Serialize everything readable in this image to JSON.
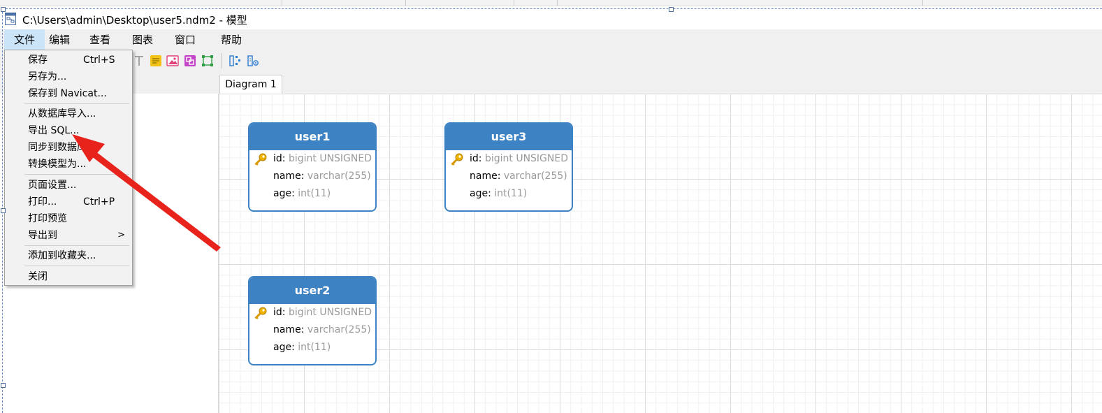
{
  "window": {
    "title": "C:\\Users\\admin\\Desktop\\user5.ndm2 - 模型"
  },
  "menubar": {
    "items": [
      {
        "label": "文件"
      },
      {
        "label": "编辑"
      },
      {
        "label": "查看"
      },
      {
        "label": "图表"
      },
      {
        "label": "窗口"
      },
      {
        "label": "帮助"
      }
    ]
  },
  "tabs": [
    {
      "label": "Diagram 1"
    }
  ],
  "file_menu": {
    "items": [
      {
        "label": "保存",
        "shortcut": "Ctrl+S"
      },
      {
        "label": "另存为..."
      },
      {
        "label": "保存到 Navicat..."
      },
      {
        "label": "从数据库导入..."
      },
      {
        "label": "导出 SQL..."
      },
      {
        "label": "同步到数据库..."
      },
      {
        "label": "转换模型为..."
      },
      {
        "label": "页面设置..."
      },
      {
        "label": "打印...",
        "shortcut": "Ctrl+P"
      },
      {
        "label": "打印预览"
      },
      {
        "label": "导出到",
        "submenu_arrow": ">"
      },
      {
        "label": "添加到收藏夹..."
      },
      {
        "label": "关闭"
      }
    ]
  },
  "entities": [
    {
      "name": "user1",
      "fields": [
        {
          "name": "id",
          "type": "bigint UNSIGNED",
          "primary_key": true
        },
        {
          "name": "name",
          "type": "varchar(255)"
        },
        {
          "name": "age",
          "type": "int(11)"
        }
      ]
    },
    {
      "name": "user3",
      "fields": [
        {
          "name": "id",
          "type": "bigint UNSIGNED",
          "primary_key": true
        },
        {
          "name": "name",
          "type": "varchar(255)"
        },
        {
          "name": "age",
          "type": "int(11)"
        }
      ]
    },
    {
      "name": "user2",
      "fields": [
        {
          "name": "id",
          "type": "bigint UNSIGNED",
          "primary_key": true
        },
        {
          "name": "name",
          "type": "varchar(255)"
        },
        {
          "name": "age",
          "type": "int(11)"
        }
      ]
    }
  ],
  "colors": {
    "entity_header": "#3d82c2",
    "menu_highlight": "#cce4f7",
    "annotation_arrow": "#e8231c",
    "field_type_text": "#9a9a9a"
  },
  "icons": {
    "app": "model-file-icon",
    "key": "primary-key-icon",
    "toolbar": [
      "text-tool-icon",
      "note-icon",
      "image-icon",
      "shape-icon",
      "layer-icon",
      "auto-layout-icon",
      "align-icon"
    ]
  }
}
